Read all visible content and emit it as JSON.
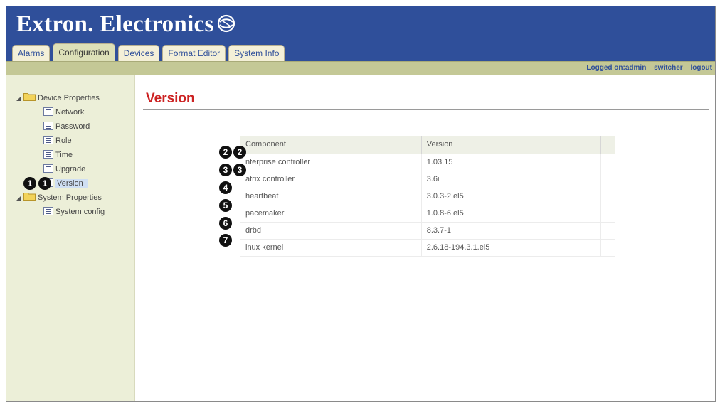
{
  "brand": {
    "name": "Extron. Electronics"
  },
  "tabs": [
    {
      "label": "Alarms"
    },
    {
      "label": "Configuration"
    },
    {
      "label": "Devices"
    },
    {
      "label": "Format Editor"
    },
    {
      "label": "System Info"
    }
  ],
  "active_tab": "Configuration",
  "status": {
    "logged_on": "Logged on:admin",
    "switcher": "switcher",
    "logout": "logout"
  },
  "sidebar": {
    "groups": [
      {
        "label": "Device Properties",
        "items": [
          "Network",
          "Password",
          "Role",
          "Time",
          "Upgrade",
          "Version"
        ]
      },
      {
        "label": "System Properties",
        "items": [
          "System config"
        ]
      }
    ],
    "selected": "Version"
  },
  "page": {
    "title": "Version"
  },
  "table": {
    "headers": [
      "Component",
      "Version"
    ],
    "rows": [
      {
        "component": "nterprise controller",
        "version": "1.03.15"
      },
      {
        "component": "atrix controller",
        "version": "3.6i"
      },
      {
        "component": "heartbeat",
        "version": "3.0.3-2.el5"
      },
      {
        "component": "pacemaker",
        "version": "1.0.8-6.el5"
      },
      {
        "component": "drbd",
        "version": "8.3.7-1"
      },
      {
        "component": "inux kernel",
        "version": "2.6.18-194.3.1.el5"
      }
    ]
  },
  "callouts": [
    "1",
    "1",
    "2",
    "2",
    "3",
    "3",
    "4",
    "5",
    "6",
    "7"
  ],
  "colors": {
    "header_bg": "#2f4f9a",
    "status_bar": "#c4c896",
    "sidebar_bg": "#ecefd8",
    "title_red": "#cc2222",
    "callout": "#111111"
  }
}
